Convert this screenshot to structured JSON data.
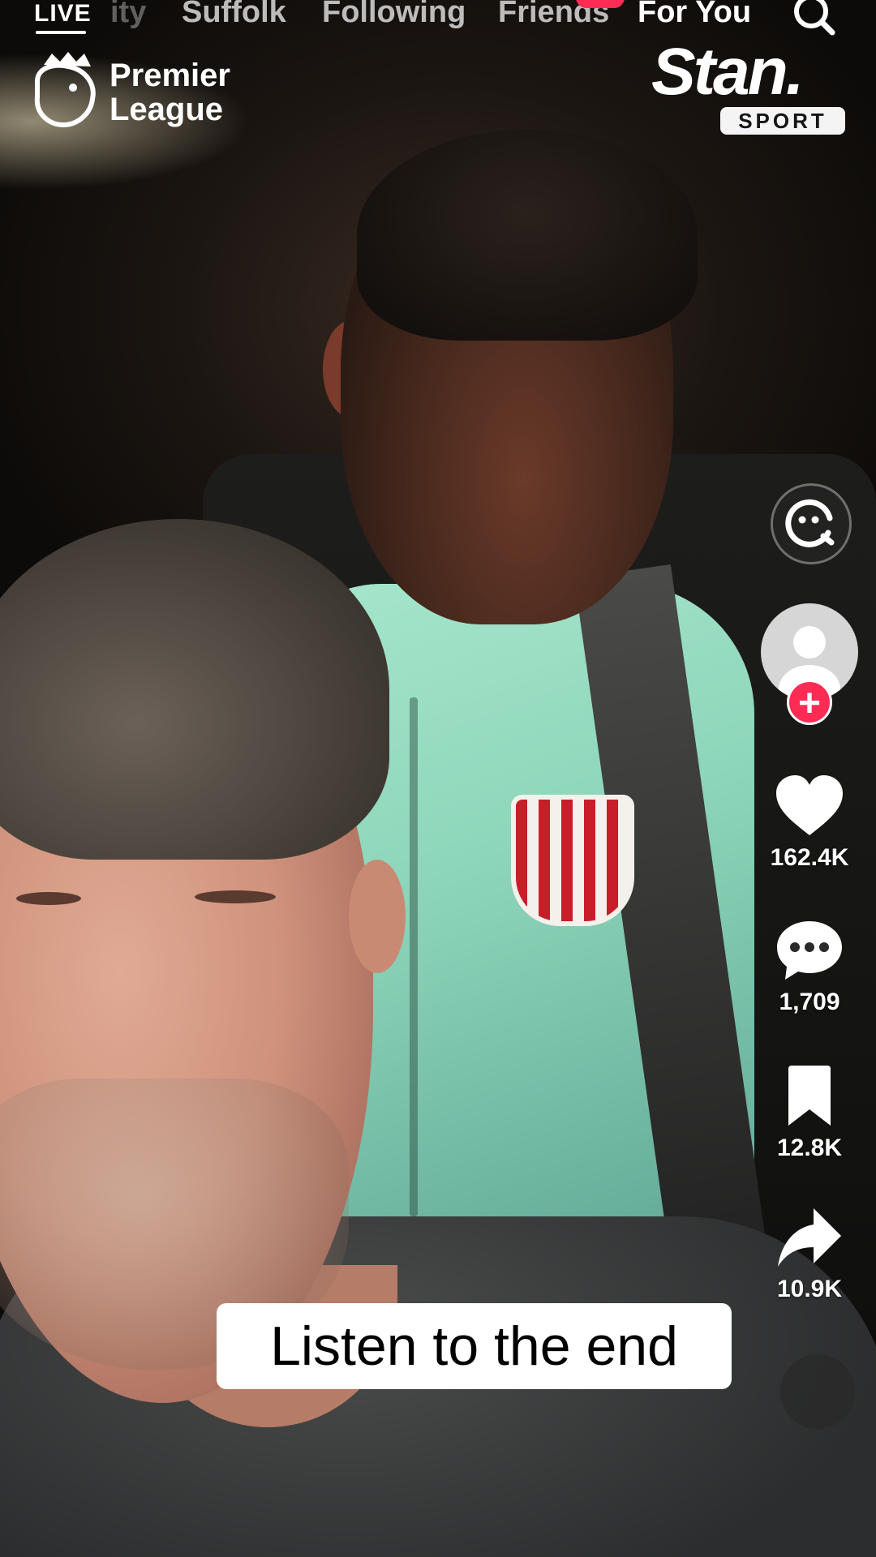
{
  "top_nav": {
    "live_label": "LIVE",
    "tabs": [
      {
        "label": "ity",
        "state": "faded"
      },
      {
        "label": "Suffolk",
        "state": "inactive"
      },
      {
        "label": "Following",
        "state": "inactive"
      },
      {
        "label": "Friends",
        "state": "inactive"
      },
      {
        "label": "For You",
        "state": "active"
      }
    ],
    "search_icon": "search-icon"
  },
  "broadcast": {
    "league_name": "Premier League",
    "broadcaster": "Stan.",
    "broadcaster_sub": "SPORT"
  },
  "right_rail": {
    "likes": "162.4K",
    "comments": "1,709",
    "saves": "12.8K",
    "shares": "10.9K"
  },
  "caption": "Listen to the end",
  "colors": {
    "accent": "#fe2c55",
    "text": "#ffffff"
  }
}
